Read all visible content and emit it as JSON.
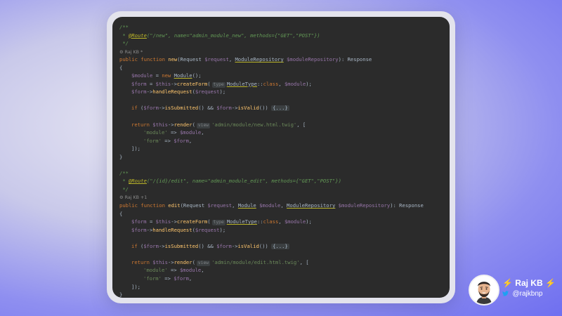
{
  "code": {
    "l1": "/**",
    "l2_pre": " * ",
    "l2_ann": "@Route",
    "l2_post": "(\"/new\", name=\"admin_module_new\", methods={\"GET\",\"POST\"})",
    "l3": " */",
    "l4_author": "⚙ Raj KB *",
    "l5": {
      "kw": "public function ",
      "fn": "new",
      "a": "(Request ",
      "v1": "$request",
      "b": ", ",
      "t1": "ModuleRepository",
      "c": " ",
      "v2": "$moduleRepository",
      "d": "): Response"
    },
    "l6": "{",
    "l7": {
      "v1": "$module",
      "a": " = ",
      "kw": "new",
      "b": " ",
      "t": "Module",
      "c": "();"
    },
    "l8": {
      "v1": "$form",
      "a": " = ",
      "v2": "$this",
      "b": "->",
      "fn": "createForm",
      "c": "(",
      "hint": "type",
      "t": "ModuleType",
      "d": "::",
      "kw": "class",
      "e": ", ",
      "v3": "$module",
      "f": ");"
    },
    "l9": {
      "v1": "$form",
      "a": "->",
      "fn": "handleRequest",
      "b": "(",
      "v2": "$request",
      "c": ");"
    },
    "l10": "",
    "l11": {
      "kw": "if",
      "a": " (",
      "v1": "$form",
      "b": "->",
      "fn1": "isSubmitted",
      "c": "() && ",
      "v2": "$form",
      "d": "->",
      "fn2": "isValid",
      "e": "()) ",
      "fold": "{...}"
    },
    "l12": "",
    "l13": {
      "kw": "return",
      "a": " ",
      "v": "$this",
      "b": "->",
      "fn": "render",
      "c": "(",
      "hint": "view",
      "str": "'admin/module/new.html.twig'",
      "d": ", ["
    },
    "l14": {
      "str": "'module'",
      "a": " => ",
      "v": "$module",
      "b": ","
    },
    "l15": {
      "str": "'form'",
      "a": " => ",
      "v": "$form",
      "b": ","
    },
    "l16": "]);",
    "l17": "}",
    "l18": "",
    "l19": "/**",
    "l20_pre": " * ",
    "l20_ann": "@Route",
    "l20_post": "(\"/{id}/edit\", name=\"admin_module_edit\", methods={\"GET\",\"POST\"})",
    "l21": " */",
    "l22_author": "⚙ Raj KB +1",
    "l23": {
      "kw": "public function ",
      "fn": "edit",
      "a": "(Request ",
      "v1": "$request",
      "b": ", ",
      "t1": "Module",
      "c": " ",
      "v2": "$module",
      "d": ", ",
      "t2": "ModuleRepository",
      "e": " ",
      "v3": "$moduleRepository",
      "f": "): Response"
    },
    "l24": "{",
    "l25": {
      "v1": "$form",
      "a": " = ",
      "v2": "$this",
      "b": "->",
      "fn": "createForm",
      "c": "(",
      "hint": "type",
      "t": "ModuleType",
      "d": "::",
      "kw": "class",
      "e": ", ",
      "v3": "$module",
      "f": ");"
    },
    "l26": {
      "v1": "$form",
      "a": "->",
      "fn": "handleRequest",
      "b": "(",
      "v2": "$request",
      "c": ");"
    },
    "l27": "",
    "l28": {
      "kw": "if",
      "a": " (",
      "v1": "$form",
      "b": "->",
      "fn1": "isSubmitted",
      "c": "() && ",
      "v2": "$form",
      "d": "->",
      "fn2": "isValid",
      "e": "()) ",
      "fold": "{...}"
    },
    "l29": "",
    "l30": {
      "kw": "return",
      "a": " ",
      "v": "$this",
      "b": "->",
      "fn": "render",
      "c": "(",
      "hint": "view",
      "str": "'admin/module/edit.html.twig'",
      "d": ", ["
    },
    "l31": {
      "str": "'module'",
      "a": " => ",
      "v": "$module",
      "b": ","
    },
    "l32": {
      "str": "'form'",
      "a": " => ",
      "v": "$form",
      "b": ","
    },
    "l33": "]);",
    "l34": "}"
  },
  "profile": {
    "bolt_left": "⚡",
    "name": "Raj KB",
    "bolt_right": "⚡",
    "twitter_icon": "twitter-icon",
    "handle": "@rajkbnp"
  },
  "colors": {
    "editor_bg": "#2b2b2b",
    "keyword": "#cc7832",
    "function": "#ffc66d",
    "variable": "#9876aa",
    "string": "#6a8759",
    "doc_comment": "#629755",
    "annotation": "#bbb529",
    "twitter": "#1da1f2",
    "bolt": "#ffd21f"
  }
}
